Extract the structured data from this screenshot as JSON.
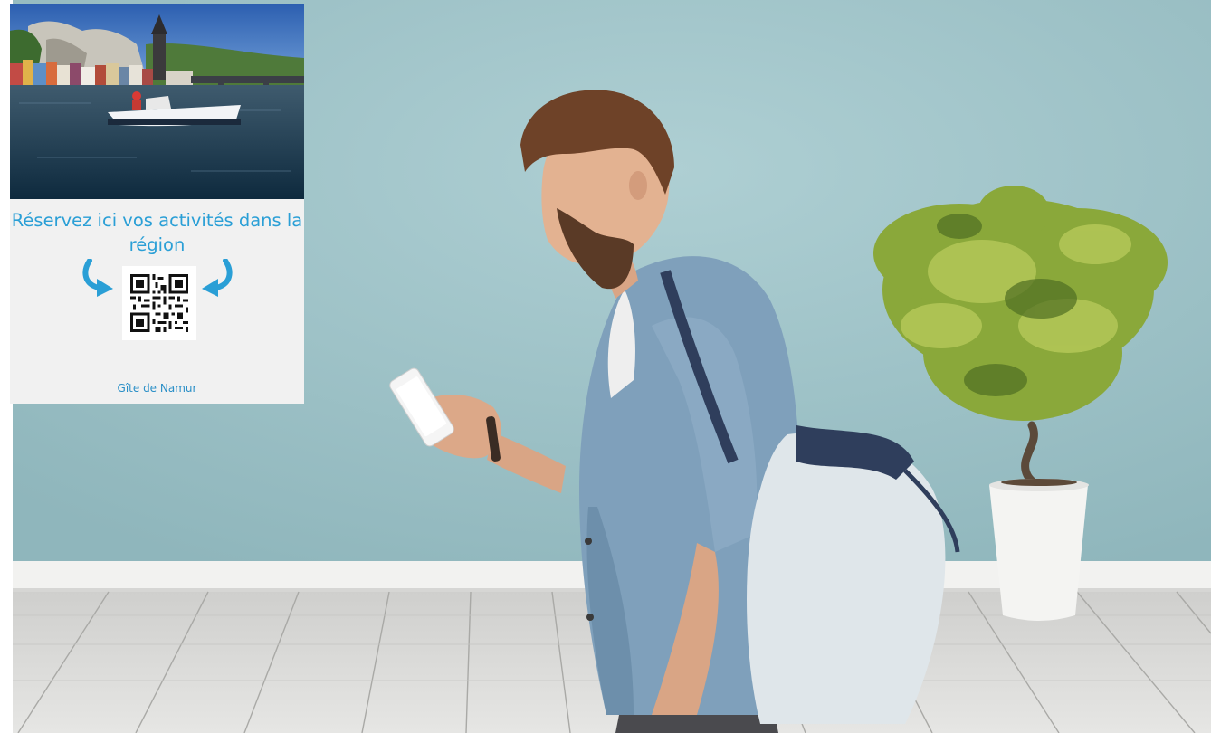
{
  "poster": {
    "title": "Réservez ici vos activités dans la région",
    "footer": "Gîte de Namur"
  },
  "colors": {
    "wall": "#9fc3c8",
    "poster_text": "#2a9fd6",
    "floor": "#d9d9d7"
  },
  "icons": {
    "left_arrow": "curved-arrow-right-icon",
    "right_arrow": "curved-arrow-left-icon",
    "qr": "qr-code-icon"
  }
}
